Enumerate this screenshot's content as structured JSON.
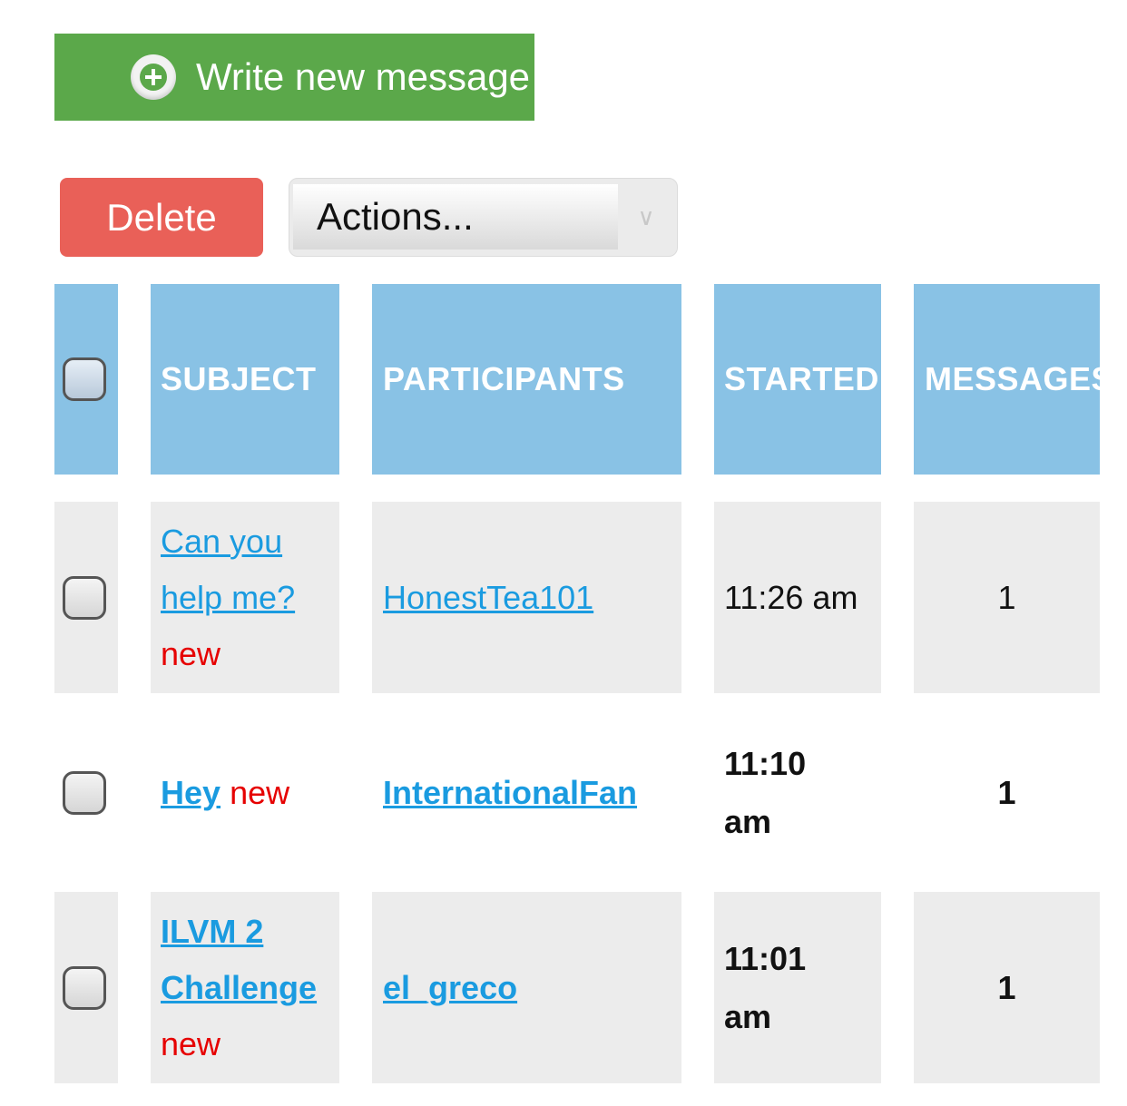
{
  "toolbar": {
    "write_new_message": "Write new message",
    "delete": "Delete",
    "actions": "Actions...",
    "actions_arrow_icon": "chevron-down-icon"
  },
  "colors": {
    "write_button": "#5ba84a",
    "delete_button": "#e96058",
    "header": "#89c2e5",
    "link": "#1a9be0",
    "new_tag": "#e60000",
    "row_gray": "#ececec"
  },
  "table": {
    "headers": {
      "subject": "SUBJECT",
      "participants": "PARTICIPANTS",
      "started": "STARTED",
      "messages": "MESSAGES"
    },
    "rows": [
      {
        "subject": "Can you help me?",
        "new_label": "new",
        "participant": "HonestTea101",
        "started": "11:26 am",
        "messages": "1",
        "unread": false
      },
      {
        "subject": "Hey",
        "new_label": "new",
        "participant": "InternationalFan",
        "started": "11:10 am",
        "messages": "1",
        "unread": true
      },
      {
        "subject": "ILVM 2 Challenge",
        "new_label": "new",
        "participant": "el_greco",
        "started": "11:01 am",
        "messages": "1",
        "unread": true
      }
    ]
  }
}
